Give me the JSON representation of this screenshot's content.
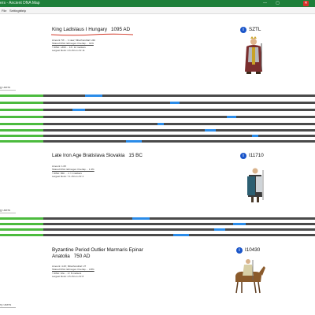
{
  "window": {
    "app_title": "ers - Ancient DNA Map",
    "controls": [
      "—",
      "▢",
      "✕"
    ]
  },
  "menu": {
    "items": [
      "File",
      "Settings",
      "Help"
    ]
  },
  "samples": [
    {
      "title": "King Ladislaus I Hungary",
      "age": "1095 AD",
      "code": "SZTL",
      "meta": [
        "Amount: 5X ... 1 view; Mitochondrial: H1b",
        "Shared DNA: Ethnogen Overlap ... 41%",
        "Y-DNA: I-Z63 ... 16 / 12 markers",
        "Largest block: 2.6 cM on chr 11"
      ],
      "figure": "king-icon",
      "figure_colors": [
        "#c9a227",
        "#7a2e2e",
        "#b6b8bb"
      ],
      "section_label": "g users",
      "tracks": [
        [
          0.27,
          0.055
        ],
        [
          0.54,
          0.03
        ],
        [
          0.23,
          0.04
        ],
        [
          0.72,
          0.03
        ],
        [
          0.5,
          0.02
        ],
        [
          0.65,
          0.035
        ],
        [
          0.8,
          0.02
        ],
        [
          0.4,
          0.05
        ]
      ]
    },
    {
      "title": "Late Iron Age Bratislava Slovakia",
      "age": "15 BC",
      "code": "I11710",
      "meta": [
        "Amount: 1.6X",
        "Shared DNA: Ethnogen Overlap ... 1.3%",
        "Y-DNA: R1b ... 1 / 1 markers",
        "Largest block: 7.1 cM on chr 4"
      ],
      "figure": "warrior-icon",
      "figure_colors": [
        "#2c5f72",
        "#cfd4d8",
        "#3b3b3b"
      ],
      "section_label": "g users",
      "tracks": [
        [
          0.42,
          0.055
        ],
        [
          0.74,
          0.04
        ],
        [
          0.68,
          0.035
        ],
        [
          0.55,
          0.05
        ]
      ]
    },
    {
      "title": "Byzantine Period Outlier Marmaris Epinar",
      "title_line2": "Anatolia",
      "age": "750 AD",
      "code": "I10430",
      "meta": [
        "Amount: 4.2X; Mitochondrial: U7",
        "Shared DNA: Ethnogen Overlap ... 3.8%",
        "Y-DNA: J2a ... 2 / 8 markers",
        "Largest block: 4.5 cM on chr 8"
      ],
      "figure": "horseman-icon",
      "figure_colors": [
        "#8a5a2b",
        "#d8cfa6",
        "#5c3b1e"
      ],
      "section_label": "ry users",
      "tracks": []
    }
  ]
}
